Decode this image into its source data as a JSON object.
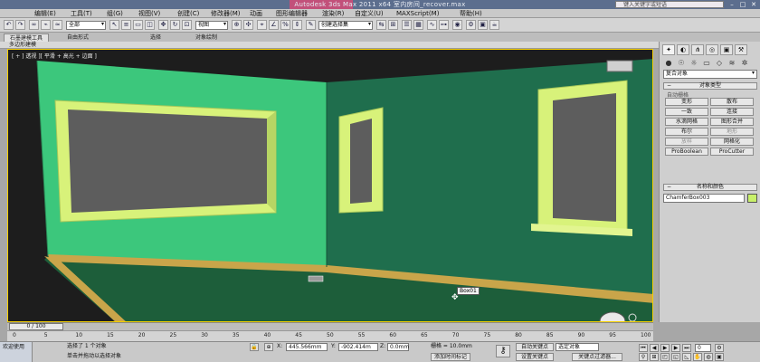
{
  "window": {
    "title": "Autodesk 3ds Max  2011 x64     室内房间_recover.max",
    "search_placeholder": "键入关键字或短语",
    "controls": [
      "–",
      "□",
      "✕"
    ]
  },
  "menu": [
    "编辑(E)",
    "工具(T)",
    "组(G)",
    "视图(V)",
    "创建(C)",
    "修改器(M)",
    "动画",
    "图形编辑器",
    "渲染(R)",
    "自定义(U)",
    "MAXScript(M)",
    "帮助(H)"
  ],
  "toolbar": {
    "selection_filter": "全部",
    "ref_coord": "视图",
    "named_selection": "创建选择集"
  },
  "ribbon": {
    "tabs": [
      "石墨建模工具",
      "自由形式",
      "选择",
      "对象绘制"
    ],
    "active_tab": "石墨建模工具",
    "sub_label": "多边形建模"
  },
  "viewport": {
    "label": "[ + ] 透视 ][ 平滑 + 高光 + 边面 ]",
    "object_label": "Box01",
    "colors": {
      "background": "#1d1d1d",
      "left_wall": "#3cc77c",
      "right_wall": "#1f6e4d",
      "floor": "#1d5e3a",
      "frames": "#d8f27a"
    }
  },
  "command_panel": {
    "category": "复合对象",
    "section_object_type": "对象类型",
    "autogrid_label": "自动栅格",
    "buttons": [
      {
        "label": "变形",
        "enabled": true
      },
      {
        "label": "散布",
        "enabled": true
      },
      {
        "label": "一致",
        "enabled": true
      },
      {
        "label": "连接",
        "enabled": true
      },
      {
        "label": "水滴网格",
        "enabled": true
      },
      {
        "label": "图形合并",
        "enabled": true
      },
      {
        "label": "布尔",
        "enabled": true
      },
      {
        "label": "地形",
        "enabled": false
      },
      {
        "label": "放样",
        "enabled": false
      },
      {
        "label": "网格化",
        "enabled": true
      },
      {
        "label": "ProBoolean",
        "enabled": true
      },
      {
        "label": "ProCutter",
        "enabled": true
      }
    ],
    "section_name_color": "名称和颜色",
    "object_name": "ChamferBox003",
    "object_color": "#c8f06a"
  },
  "timeline": {
    "frame_readout": "0 / 100",
    "ticks": [
      "0",
      "5",
      "10",
      "15",
      "20",
      "25",
      "30",
      "35",
      "40",
      "45",
      "50",
      "55",
      "60",
      "65",
      "70",
      "75",
      "80",
      "85",
      "90",
      "95",
      "100"
    ]
  },
  "status": {
    "maxscript_label": "欢迎使用",
    "selection_info": "选择了 1 个对象",
    "prompt": "单击并拖动以选择对象",
    "x_label": "X:",
    "x_value": "445.566mm",
    "y_label": "Y:",
    "y_value": "-902.414m",
    "z_label": "Z:",
    "z_value": "0.0mm",
    "grid_label": "栅格 = 10.0mm",
    "add_time_tag": "添加时间标记",
    "auto_key": "自动关键点",
    "selected_combo": "选定对象",
    "set_key": "设置关键点",
    "key_filters": "关键点过滤器...",
    "frame_field": "0"
  }
}
